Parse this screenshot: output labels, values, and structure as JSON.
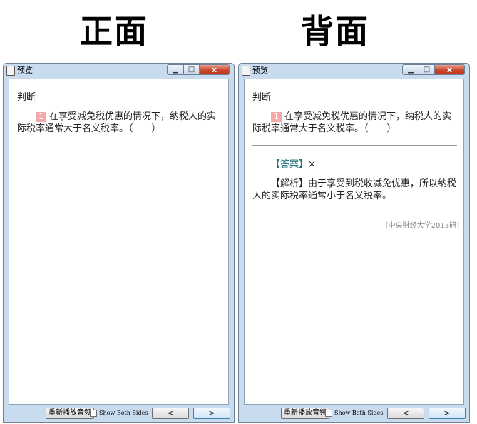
{
  "front": {
    "heading": "正面",
    "window_title": "预览",
    "category": "判断",
    "question_number": "1",
    "question_text": "在享受减免税优惠的情况下，纳税人的实际税率通常大于名义税率。（　　）"
  },
  "back": {
    "heading": "背面",
    "window_title": "预览",
    "category": "判断",
    "question_number": "1",
    "question_text": "在享受减免税优惠的情况下，纳税人的实际税率通常大于名义税率。（　　）",
    "answer_label": "【答案】",
    "answer_value": "×",
    "analysis": "【解析】由于享受到税收减免优惠，所以纳税人的实际税率通常小于名义税率。",
    "source": "[中央财经大学2013研]"
  },
  "controls": {
    "replay_label": "重新播放音频",
    "show_both_label": "Show Both Sides",
    "prev_glyph": "<",
    "next_glyph": ">",
    "show_both_checked": false
  },
  "icons": {
    "minimize": "minimize-icon",
    "maximize": "maximize-icon",
    "close": "close-icon"
  },
  "colors": {
    "frame": "#c9dcef",
    "close_button": "#c9462c",
    "question_badge": "#f2a9a9",
    "answer_label": "#1d6f78"
  }
}
